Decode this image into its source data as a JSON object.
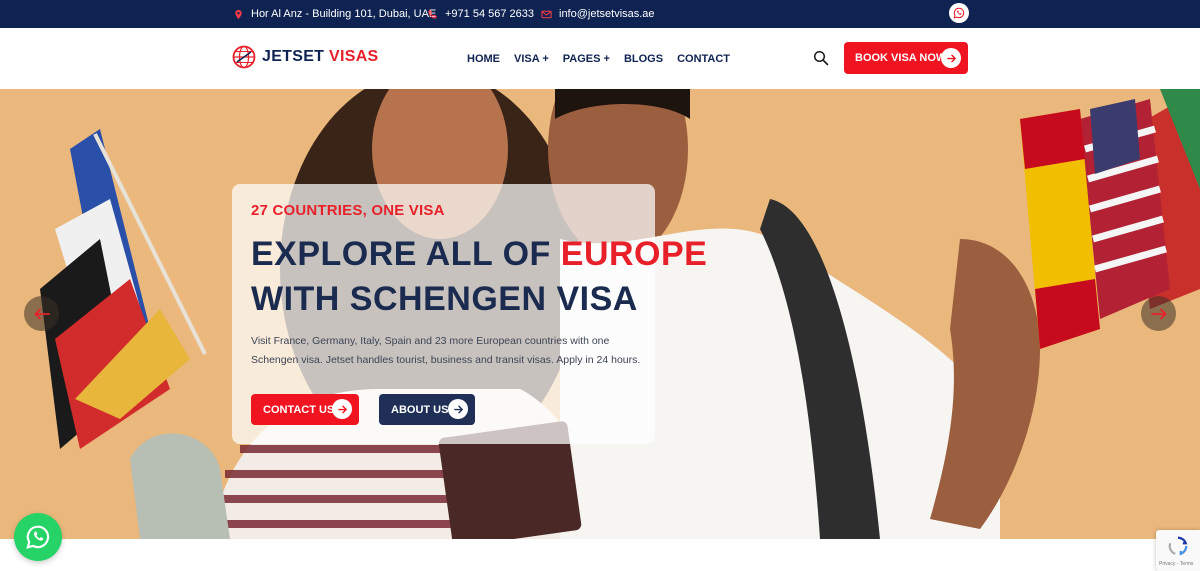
{
  "topbar": {
    "address": "Hor Al Anz - Building 101, Dubai, UAE",
    "phone": "+971 54 567 2633",
    "email": "info@jetsetvisas.ae",
    "icons": [
      "map-pin-icon",
      "phone-icon",
      "mail-icon",
      "whatsapp-icon"
    ]
  },
  "header": {
    "brand_part1": "JETSET",
    "brand_part2": "VISAS",
    "nav": [
      "HOME",
      "VISA +",
      "PAGES +",
      "BLOGS",
      "CONTACT"
    ],
    "cta": "BOOK VISA NOW"
  },
  "hero": {
    "eyebrow": "27 COUNTRIES, ONE VISA",
    "headline_part1": "EXPLORE ALL OF",
    "headline_highlight": "EUROPE",
    "headline_line2": "WITH SCHENGEN VISA",
    "description": "Visit France, Germany, Italy, Spain and 23 more European countries with one Schengen visa. Jetset handles tourist, business and transit visas. Apply in 24 hours.",
    "button_contact": "CONTACT US",
    "button_about": "ABOUT US"
  },
  "recaptcha": {
    "footer": "Privacy - Terms"
  },
  "colors": {
    "navy": "#0f2352",
    "red": "#f01320",
    "whatsapp": "#25d366",
    "hero_background": "#e9b67a"
  }
}
